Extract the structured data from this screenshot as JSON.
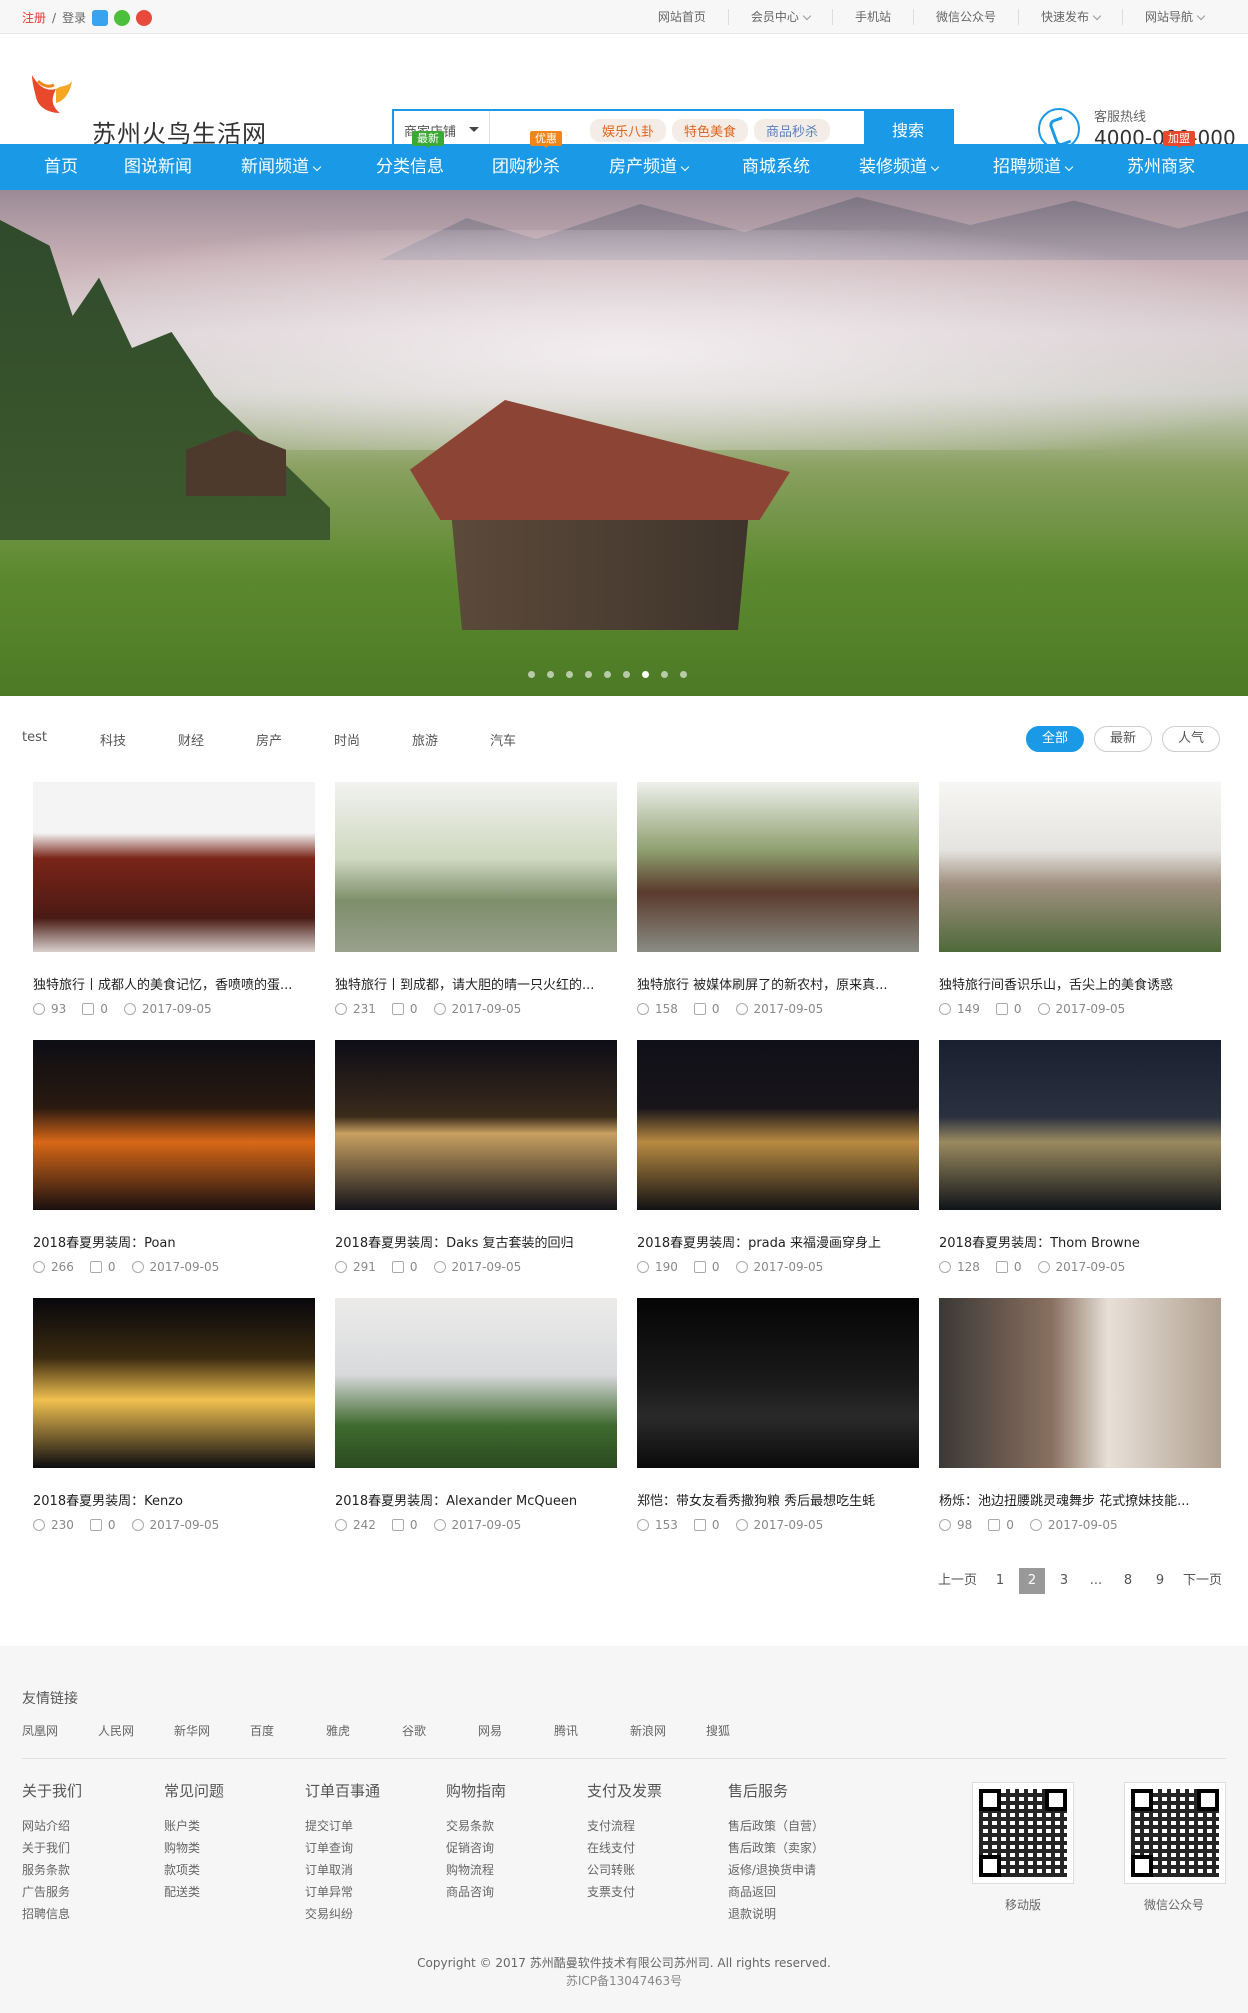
{
  "topbar": {
    "register": "注册",
    "sep": "/",
    "login": "登录",
    "links": [
      "网站首页",
      "会员中心",
      "手机站",
      "微信公众号",
      "快速发布",
      "网站导航"
    ]
  },
  "header": {
    "site_name": "苏州火鸟生活网",
    "search_category": "商家店铺",
    "hot_tags": [
      "娱乐八卦",
      "特色美食",
      "商品秒杀"
    ],
    "search_button": "搜索",
    "hotline_label": "客服热线",
    "hotline_number": "4000-000-000"
  },
  "nav": {
    "items": [
      "首页",
      "图说新闻",
      "新闻频道",
      "分类信息",
      "团购秒杀",
      "房产频道",
      "商城系统",
      "装修频道",
      "招聘频道",
      "苏州商家"
    ],
    "badges": {
      "classified": "最新",
      "groupbuy": "优惠",
      "merchant": "加盟"
    }
  },
  "filter": {
    "tabs": [
      "test",
      "科技",
      "财经",
      "房产",
      "时尚",
      "旅游",
      "汽车"
    ],
    "sorts": [
      "全部",
      "最新",
      "人气"
    ]
  },
  "articles": [
    {
      "title": "独特旅行丨成都人的美食记忆，香喷喷的蛋...",
      "views": "93",
      "comments": "0",
      "date": "2017-09-05"
    },
    {
      "title": "独特旅行丨到成都，请大胆的晴一只火红的...",
      "views": "231",
      "comments": "0",
      "date": "2017-09-05"
    },
    {
      "title": "独特旅行 被媒体刷屏了的新农村，原来真...",
      "views": "158",
      "comments": "0",
      "date": "2017-09-05"
    },
    {
      "title": "独特旅行间香识乐山，舌尖上的美食诱惑",
      "views": "149",
      "comments": "0",
      "date": "2017-09-05"
    },
    {
      "title": "2018春夏男装周：Poan",
      "views": "266",
      "comments": "0",
      "date": "2017-09-05"
    },
    {
      "title": "2018春夏男装周：Daks 复古套装的回归",
      "views": "291",
      "comments": "0",
      "date": "2017-09-05"
    },
    {
      "title": "2018春夏男装周：prada 来福漫画穿身上",
      "views": "190",
      "comments": "0",
      "date": "2017-09-05"
    },
    {
      "title": "2018春夏男装周：Thom Browne",
      "views": "128",
      "comments": "0",
      "date": "2017-09-05"
    },
    {
      "title": "2018春夏男装周：Kenzo",
      "views": "230",
      "comments": "0",
      "date": "2017-09-05"
    },
    {
      "title": "2018春夏男装周：Alexander McQueen",
      "views": "242",
      "comments": "0",
      "date": "2017-09-05"
    },
    {
      "title": "郑恺：带女友看秀撒狗粮 秀后最想吃生蚝",
      "views": "153",
      "comments": "0",
      "date": "2017-09-05"
    },
    {
      "title": "杨烁：池边扭腰跳灵魂舞步 花式撩妹技能...",
      "views": "98",
      "comments": "0",
      "date": "2017-09-05"
    }
  ],
  "pager": [
    "上一页",
    "1",
    "2",
    "3",
    "...",
    "8",
    "9",
    "下一页"
  ],
  "footer": {
    "friend_links_title": "友情链接",
    "friend_links": [
      "凤凰网",
      "人民网",
      "新华网",
      "百度",
      "雅虎",
      "谷歌",
      "网易",
      "腾讯",
      "新浪网",
      "搜狐"
    ],
    "columns": [
      {
        "title": "关于我们",
        "links": [
          "网站介绍",
          "关于我们",
          "服务条款",
          "广告服务",
          "招聘信息"
        ]
      },
      {
        "title": "常见问题",
        "links": [
          "账户类",
          "购物类",
          "款项类",
          "配送类"
        ]
      },
      {
        "title": "订单百事通",
        "links": [
          "提交订单",
          "订单查询",
          "订单取消",
          "订单异常",
          "交易纠纷"
        ]
      },
      {
        "title": "购物指南",
        "links": [
          "交易条款",
          "促销咨询",
          "购物流程",
          "商品咨询"
        ]
      },
      {
        "title": "支付及发票",
        "links": [
          "支付流程",
          "在线支付",
          "公司转账",
          "支票支付"
        ]
      },
      {
        "title": "售后服务",
        "links": [
          "售后政策（自营）",
          "售后政策（卖家）",
          "返修/退换货申请",
          "商品返回",
          "退款说明"
        ]
      }
    ],
    "qr_labels": [
      "移动版",
      "微信公众号"
    ],
    "copyright": "Copyright © 2017 苏州酷曼软件技术有限公司苏州司. All rights reserved.",
    "icp": "苏ICP备13047463号"
  },
  "colors": {
    "primary": "#1a9ae6",
    "accent_red": "#e33333"
  }
}
